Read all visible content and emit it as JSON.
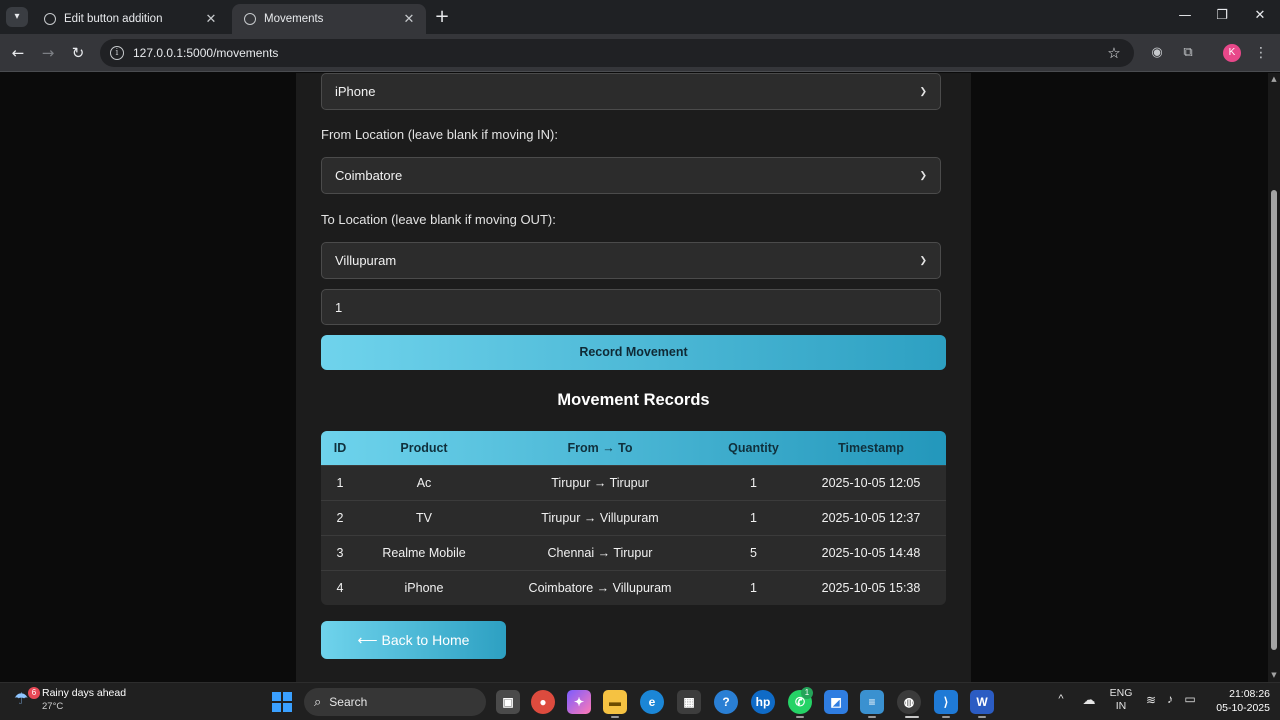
{
  "browser": {
    "tabs": [
      {
        "label": "Edit button addition",
        "active": false
      },
      {
        "label": "Movements",
        "active": true
      }
    ],
    "url": "127.0.0.1:5000/movements",
    "profile_initial": "K"
  },
  "form": {
    "product_value": "iPhone",
    "from_label": "From Location (leave blank if moving IN):",
    "from_value": "Coimbatore",
    "to_label": "To Location (leave blank if moving OUT):",
    "to_value": "Villupuram",
    "quantity_value": "1",
    "submit_label": "Record Movement"
  },
  "records": {
    "title": "Movement Records",
    "headers": [
      "ID",
      "Product",
      "From → To",
      "Quantity",
      "Timestamp"
    ],
    "rows": [
      {
        "id": "1",
        "product": "Ac",
        "from_to": "Tirupur → Tirupur",
        "quantity": "1",
        "timestamp": "2025-10-05 12:05"
      },
      {
        "id": "2",
        "product": "TV",
        "from_to": "Tirupur → Villupuram",
        "quantity": "1",
        "timestamp": "2025-10-05 12:37"
      },
      {
        "id": "3",
        "product": "Realme Mobile",
        "from_to": "Chennai → Tirupur",
        "quantity": "5",
        "timestamp": "2025-10-05 14:48"
      },
      {
        "id": "4",
        "product": "iPhone",
        "from_to": "Coimbatore → Villupuram",
        "quantity": "1",
        "timestamp": "2025-10-05 15:38"
      }
    ]
  },
  "back_label": "⟵ Back to Home",
  "taskbar": {
    "weather_badge": "6",
    "weather_text": "Rainy days ahead",
    "temperature": "27°C",
    "search_placeholder": "Search",
    "whatsapp_badge": "1",
    "lang_top": "ENG",
    "lang_bottom": "IN",
    "time": "21:08:26",
    "date": "05-10-2025"
  },
  "colors": {
    "accent_start": "#6fd3ec",
    "accent_end": "#2da0c2",
    "card_bg": "#1c1c1c",
    "page_bg": "#0b0b0b"
  }
}
